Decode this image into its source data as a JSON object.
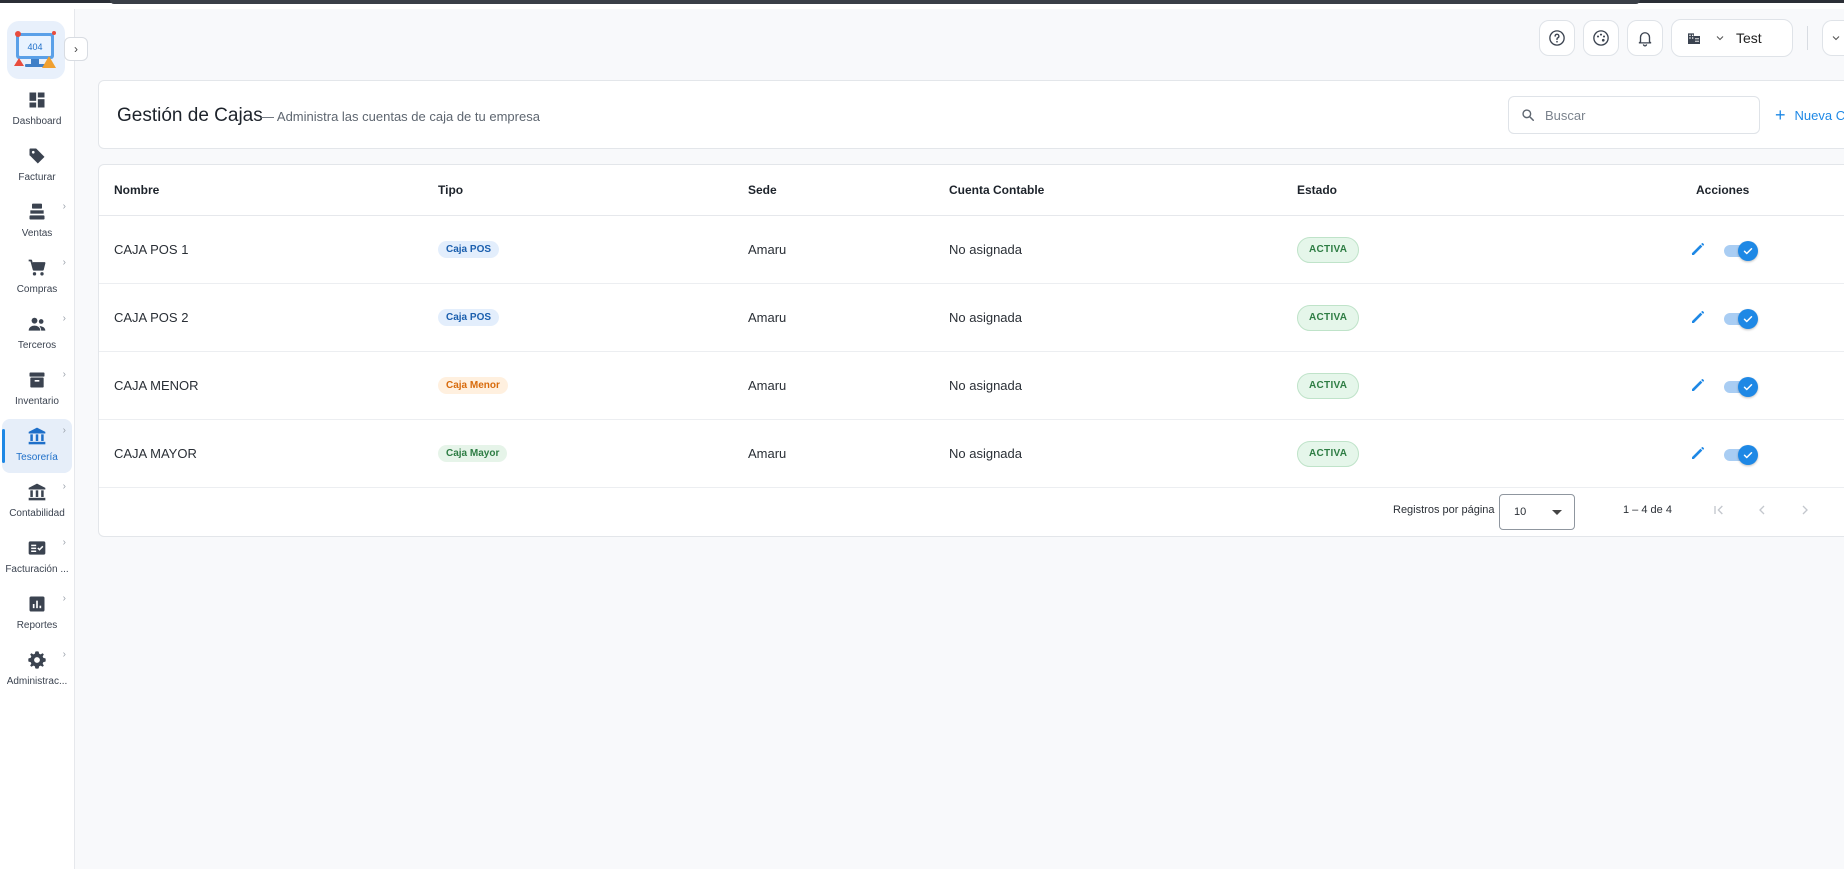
{
  "sidebar": {
    "logo_text": "404",
    "items": [
      {
        "label": "Dashboard",
        "icon": "dashboard-icon",
        "has_children": false,
        "active": false
      },
      {
        "label": "Facturar",
        "icon": "tag-icon",
        "has_children": false,
        "active": false
      },
      {
        "label": "Ventas",
        "icon": "register-icon",
        "has_children": true,
        "active": false
      },
      {
        "label": "Compras",
        "icon": "cart-icon",
        "has_children": true,
        "active": false
      },
      {
        "label": "Terceros",
        "icon": "people-icon",
        "has_children": true,
        "active": false
      },
      {
        "label": "Inventario",
        "icon": "archive-icon",
        "has_children": true,
        "active": false
      },
      {
        "label": "Tesorería",
        "icon": "bank-icon",
        "has_children": true,
        "active": true
      },
      {
        "label": "Contabilidad",
        "icon": "bank-icon",
        "has_children": true,
        "active": false
      },
      {
        "label": "Facturación ...",
        "icon": "fact-check-icon",
        "has_children": true,
        "active": false
      },
      {
        "label": "Reportes",
        "icon": "report-icon",
        "has_children": true,
        "active": false
      },
      {
        "label": "Administrac...",
        "icon": "gear-icon",
        "has_children": true,
        "active": false
      }
    ]
  },
  "header": {
    "company_name": "Test"
  },
  "page": {
    "title": "Gestión de Cajas",
    "subtitle": "— Administra las cuentas de caja de tu empresa",
    "search_placeholder": "Buscar",
    "new_button_label": "Nueva C"
  },
  "table": {
    "columns": [
      "Nombre",
      "Tipo",
      "Sede",
      "Cuenta Contable",
      "Estado",
      "Acciones"
    ],
    "rows": [
      {
        "nombre": "CAJA POS 1",
        "tipo": "Caja POS",
        "tipo_color": "blue",
        "sede": "Amaru",
        "cuenta": "No asignada",
        "estado": "ACTIVA",
        "enabled": true
      },
      {
        "nombre": "CAJA POS 2",
        "tipo": "Caja POS",
        "tipo_color": "blue",
        "sede": "Amaru",
        "cuenta": "No asignada",
        "estado": "ACTIVA",
        "enabled": true
      },
      {
        "nombre": "CAJA MENOR",
        "tipo": "Caja Menor",
        "tipo_color": "orange",
        "sede": "Amaru",
        "cuenta": "No asignada",
        "estado": "ACTIVA",
        "enabled": true
      },
      {
        "nombre": "CAJA MAYOR",
        "tipo": "Caja Mayor",
        "tipo_color": "green-t",
        "sede": "Amaru",
        "cuenta": "No asignada",
        "estado": "ACTIVA",
        "enabled": true
      }
    ]
  },
  "pagination": {
    "per_page_label": "Registros por página",
    "per_page_value": "10",
    "range": "1 – 4 de 4"
  },
  "colors": {
    "accent": "#1e88e5",
    "active_badge_bg": "#e5f6ea",
    "active_badge_text": "#2e7d44"
  }
}
